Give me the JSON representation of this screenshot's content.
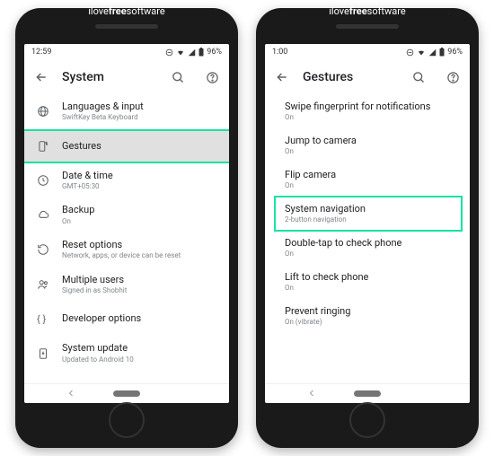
{
  "brand_html": "ilovefreesoftware",
  "left": {
    "time": "12:59",
    "battery": "96%",
    "title": "System",
    "items": [
      {
        "title": "Languages & input",
        "sub": "SwiftKey Beta Keyboard"
      },
      {
        "title": "Gestures",
        "sub": ""
      },
      {
        "title": "Date & time",
        "sub": "GMT+05:30"
      },
      {
        "title": "Backup",
        "sub": "On"
      },
      {
        "title": "Reset options",
        "sub": "Network, apps, or device can be reset"
      },
      {
        "title": "Multiple users",
        "sub": "Signed in as Shobhit"
      },
      {
        "title": "Developer options",
        "sub": ""
      },
      {
        "title": "System update",
        "sub": "Updated to Android 10"
      }
    ]
  },
  "right": {
    "time": "1:00",
    "battery": "96%",
    "title": "Gestures",
    "items": [
      {
        "title": "Swipe fingerprint for notifications",
        "sub": "On"
      },
      {
        "title": "Jump to camera",
        "sub": "On"
      },
      {
        "title": "Flip camera",
        "sub": "On"
      },
      {
        "title": "System navigation",
        "sub": "2-button navigation"
      },
      {
        "title": "Double-tap to check phone",
        "sub": "On"
      },
      {
        "title": "Lift to check phone",
        "sub": "On"
      },
      {
        "title": "Prevent ringing",
        "sub": "On (vibrate)"
      }
    ]
  }
}
